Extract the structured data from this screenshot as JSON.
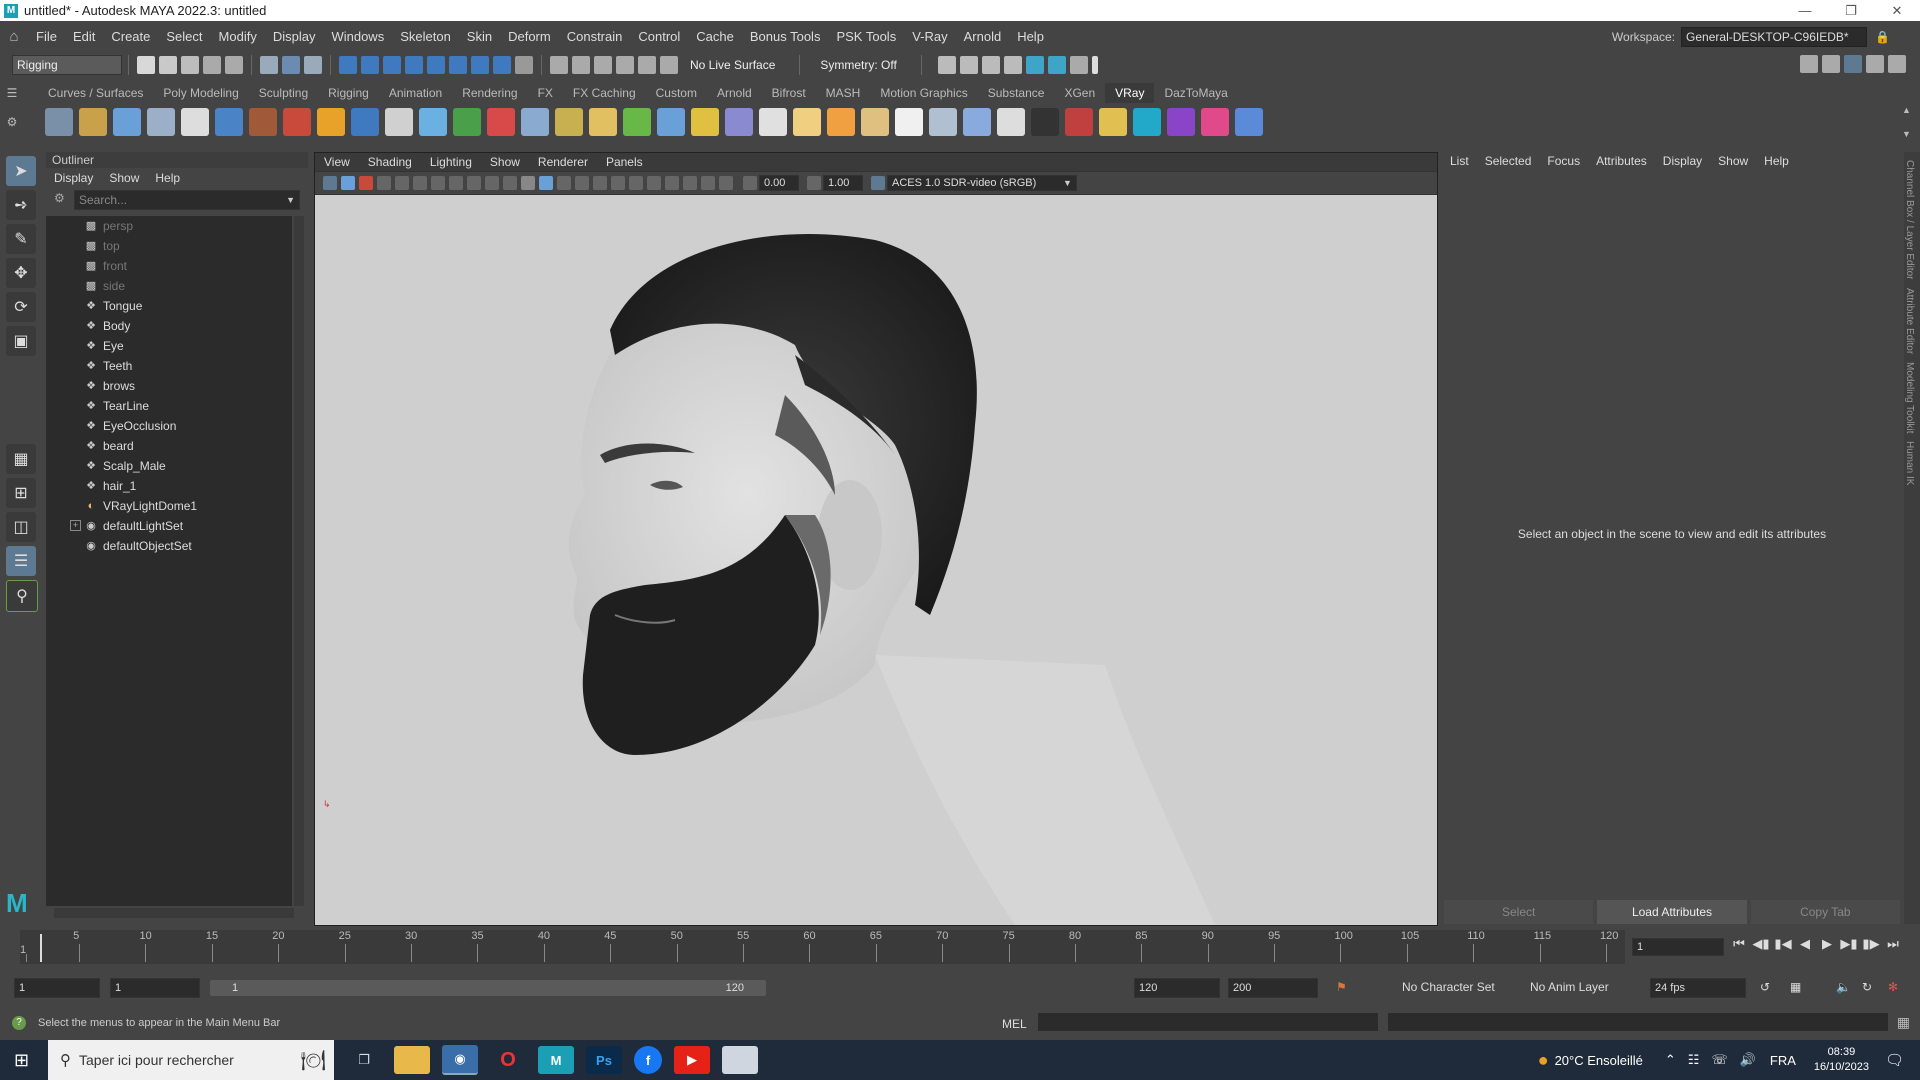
{
  "window": {
    "title": "untitled* - Autodesk MAYA 2022.3: untitled",
    "app_badge": "M"
  },
  "menubar": {
    "items": [
      "File",
      "Edit",
      "Create",
      "Select",
      "Modify",
      "Display",
      "Windows",
      "Skeleton",
      "Skin",
      "Deform",
      "Constrain",
      "Control",
      "Cache",
      "Bonus Tools",
      "PSK Tools",
      "V-Ray",
      "Arnold",
      "Help"
    ],
    "workspace_label": "Workspace:",
    "workspace_value": "General-DESKTOP-C96IEDB*"
  },
  "statusline": {
    "menuset": "Rigging",
    "live_surface": "No Live Surface",
    "symmetry": "Symmetry: Off"
  },
  "shelf": {
    "tabs": [
      "Curves / Surfaces",
      "Poly Modeling",
      "Sculpting",
      "Rigging",
      "Animation",
      "Rendering",
      "FX",
      "FX Caching",
      "Custom",
      "Arnold",
      "Bifrost",
      "MASH",
      "Motion Graphics",
      "Substance",
      "XGen",
      "VRay",
      "DazToMaya"
    ],
    "active_tab": "VRay",
    "icon_colors": [
      "#7a8fa8",
      "#c9a14a",
      "#6aa0d8",
      "#9bb0c8",
      "#dddddd",
      "#4a84c6",
      "#a05a3a",
      "#c84a3a",
      "#e8a22a",
      "#3f7ac0",
      "#d0d0d0",
      "#6ab0e0",
      "#4aa04a",
      "#d84a4a",
      "#8aaad0",
      "#c8b050",
      "#e0c060",
      "#68b848",
      "#6aa0d8",
      "#e0c040",
      "#8a8ad0",
      "#e0e0e0",
      "#f0d080",
      "#f0a040",
      "#e0c080",
      "#f0f0f0",
      "#b0c0d0",
      "#88aadd",
      "#dddddd",
      "#333333",
      "#c04040",
      "#e0c050",
      "#22a8c8",
      "#8a44c8",
      "#e04a8a",
      "#5a8ad8"
    ]
  },
  "outliner": {
    "title": "Outliner",
    "menu": [
      "Display",
      "Show",
      "Help"
    ],
    "search_placeholder": "Search...",
    "items": [
      {
        "label": "persp",
        "icon": "camera-icon",
        "dim": true
      },
      {
        "label": "top",
        "icon": "camera-icon",
        "dim": true
      },
      {
        "label": "front",
        "icon": "camera-icon",
        "dim": true
      },
      {
        "label": "side",
        "icon": "camera-icon",
        "dim": true
      },
      {
        "label": "Tongue",
        "icon": "transform-icon",
        "dim": false
      },
      {
        "label": "Body",
        "icon": "transform-icon",
        "dim": false
      },
      {
        "label": "Eye",
        "icon": "transform-icon",
        "dim": false
      },
      {
        "label": "Teeth",
        "icon": "transform-icon",
        "dim": false
      },
      {
        "label": "brows",
        "icon": "transform-icon",
        "dim": false
      },
      {
        "label": "TearLine",
        "icon": "transform-icon",
        "dim": false
      },
      {
        "label": "EyeOcclusion",
        "icon": "transform-icon",
        "dim": false
      },
      {
        "label": "beard",
        "icon": "transform-icon",
        "dim": false
      },
      {
        "label": "Scalp_Male",
        "icon": "transform-icon",
        "dim": false
      },
      {
        "label": "hair_1",
        "icon": "transform-icon",
        "dim": false
      },
      {
        "label": "VRayLightDome1",
        "icon": "dome-light-icon",
        "dim": false
      },
      {
        "label": "defaultLightSet",
        "icon": "set-icon",
        "dim": false,
        "expandable": true
      },
      {
        "label": "defaultObjectSet",
        "icon": "set-icon",
        "dim": false
      }
    ]
  },
  "viewport": {
    "menu": [
      "View",
      "Shading",
      "Lighting",
      "Show",
      "Renderer",
      "Panels"
    ],
    "exposure": "0.00",
    "gamma": "1.00",
    "color_space": "ACES 1.0 SDR-video (sRGB)"
  },
  "attribute_editor": {
    "menu": [
      "List",
      "Selected",
      "Focus",
      "Attributes",
      "Display",
      "Show",
      "Help"
    ],
    "message": "Select an object in the scene to view and edit its attributes",
    "buttons": [
      "Select",
      "Load Attributes",
      "Copy Tab"
    ]
  },
  "side_tabs": [
    "Channel Box / Layer Editor",
    "Attribute Editor",
    "Modeling Toolkit",
    "Human IK"
  ],
  "timeslider": {
    "ticks": [
      "1",
      "5",
      "10",
      "15",
      "20",
      "25",
      "30",
      "35",
      "40",
      "45",
      "50",
      "55",
      "60",
      "65",
      "70",
      "75",
      "80",
      "85",
      "90",
      "95",
      "100",
      "105",
      "110",
      "115",
      "120"
    ],
    "current_frame": "1"
  },
  "range": {
    "start": "1",
    "playback_start": "1",
    "bar_start": "1",
    "bar_end": "120",
    "playback_end": "120",
    "end": "200",
    "character_set": "No Character Set",
    "anim_layer": "No Anim Layer",
    "fps": "24 fps"
  },
  "helpline": {
    "text": "Select the menus to appear in the Main Menu Bar",
    "mel_label": "MEL"
  },
  "taskbar": {
    "search_placeholder": "Taper ici pour rechercher",
    "weather": "20°C  Ensoleillé",
    "lang": "FRA",
    "time": "08:39",
    "date": "16/10/2023"
  }
}
